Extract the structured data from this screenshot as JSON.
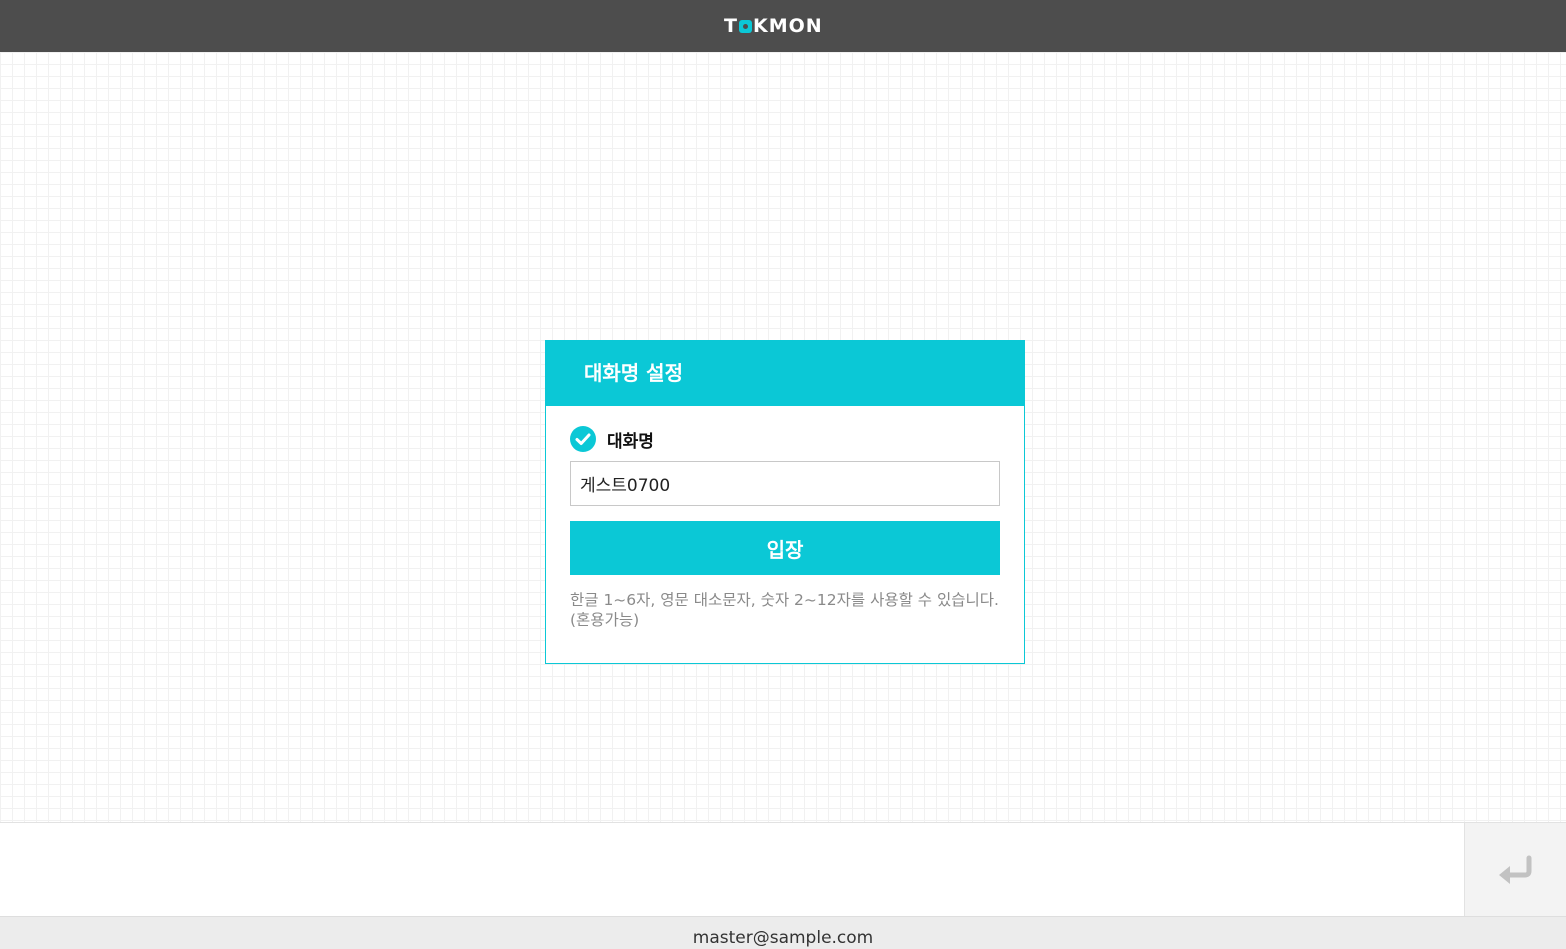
{
  "header": {
    "logo_pre": "T",
    "logo_post": "KMON"
  },
  "nickname_dialog": {
    "title": "대화명 설정",
    "field_label": "대화명",
    "input_value": "게스트0700",
    "enter_label": "입장",
    "hint": "한글 1~6자, 영문 대소문자, 숫자 2~12자를 사용할 수 있습니다. (혼용가능)"
  },
  "chat_input": {
    "placeholder": "",
    "send_icon": "enter-arrow-icon"
  },
  "footer": {
    "email": "master@sample.com"
  },
  "colors": {
    "accent": "#0bc8d6",
    "topbar": "#4d4d4d",
    "footer": "#ececec"
  }
}
